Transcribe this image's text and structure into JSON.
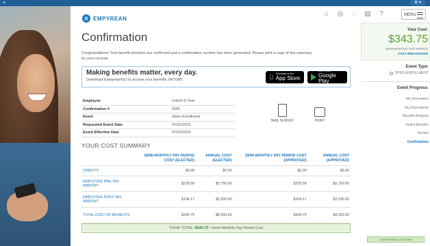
{
  "browser": {
    "menu_icon": "hamburger-icon",
    "pill_label": "⚙ ▾"
  },
  "header": {
    "brand": "EMPYREAN",
    "icons": [
      "home-icon",
      "help-icon",
      "chat-icon",
      "document-icon",
      "question-icon"
    ],
    "menu_label": "MENU"
  },
  "page": {
    "title": "Confirmation",
    "congrats": "Congratulations! Your benefit elections are confirmed and a confirmation number has been generated. Please print a copy of this summary for your records."
  },
  "promo": {
    "heading": "Making benefits matter, every day.",
    "subtext": "Download EmpyreanGO to access your benefits 24/7/365.",
    "apple_small": "Download on the",
    "apple_big": "App Store",
    "google_small": "GET IT ON",
    "google_big": "Google Play"
  },
  "info": [
    {
      "label": "Employee",
      "value": "Unit10 D Test"
    },
    {
      "label": "Confirmation #",
      "value": "8281"
    },
    {
      "label": "Event",
      "value": "Open Enrollment"
    },
    {
      "label": "Requested Event Date",
      "value": "07/01/2023"
    },
    {
      "label": "Event Effective Date",
      "value": "07/01/2023"
    }
  ],
  "actions": {
    "survey": "TAKE SURVEY",
    "print": "PRINT"
  },
  "cost_summary": {
    "title": "YOUR COST SUMMARY",
    "headers": [
      "SEMI-MONTHLY PAY PERIOD COST (ELECTED)",
      "ANNUAL COST (ELECTED)",
      "SEMI-MONTHLY PAY PERIOD COST (APPROVED)",
      "ANNUAL COST (APPROVED)"
    ],
    "rows": [
      {
        "label": "CREDITS",
        "values": [
          "$0.00",
          "$0.00",
          "$0.00",
          "$0.00"
        ]
      },
      {
        "label": "EMPLOYEE PRE-TAX AMOUNT",
        "values": [
          "$239.58",
          "$5,750.00",
          "$239.58",
          "$5,750.00"
        ]
      },
      {
        "label": "EMPLOYEE POST-TAX AMOUNT",
        "values": [
          "$104.17",
          "$2,500.00",
          "$104.17",
          "$2,500.00"
        ]
      },
      {
        "label": "TOTAL COST OF BENEFITS",
        "values": [
          "$343.75",
          "$8,250.00",
          "$343.75",
          "$8,250.00"
        ]
      }
    ],
    "total_prefix": "YOUR TOTAL:",
    "total_amount": "$343.75",
    "total_suffix": "/ Semi-Monthly Pay Period Cost"
  },
  "sidebar": {
    "cost_label": "Your Cost:",
    "cost_amount": "$343.75",
    "period": "SEMI-MONTHLY PAY PERIOD",
    "breakdown": "COST BREAKDOWN",
    "event_type_label": "Event Type:",
    "event_type_value": "OPEN ENROLLMENT",
    "progress_label": "Event Progress:",
    "steps": [
      "My Information",
      "My Dependents",
      "Benefits Analysis",
      "Select Benefits",
      "Review",
      "Confirmation"
    ],
    "badge": "CONFIRMED ELECTIONS"
  },
  "colors": {
    "accent": "#1b75bb",
    "success": "#5aa02c",
    "browser_bar": "#1e5f96"
  }
}
